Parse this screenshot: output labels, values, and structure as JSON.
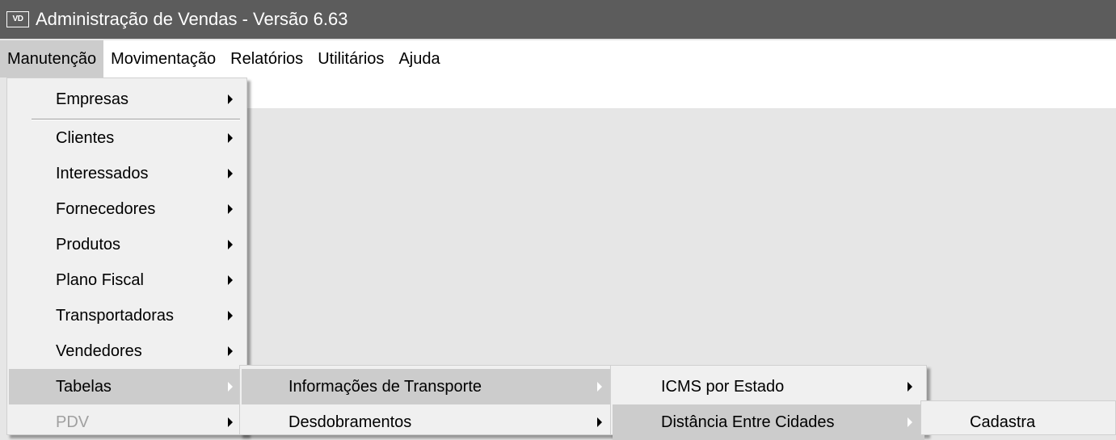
{
  "titlebar": {
    "icon_text": "VD",
    "title": "Administração de Vendas - Versão 6.63"
  },
  "menubar": {
    "items": [
      "Manutenção",
      "Movimentação",
      "Relatórios",
      "Utilitários",
      "Ajuda"
    ],
    "active_item": "Manutenção"
  },
  "menu_manutencao": {
    "items": [
      "Empresas",
      "Clientes",
      "Interessados",
      "Fornecedores",
      "Produtos",
      "Plano Fiscal",
      "Transportadoras",
      "Vendedores",
      "Tabelas",
      "PDV"
    ],
    "highlighted": "Tabelas",
    "disabled": [
      "PDV"
    ]
  },
  "menu_tabelas": {
    "items": [
      "Informações de Transporte",
      "Desdobramentos"
    ],
    "highlighted": "Informações de Transporte"
  },
  "menu_transporte": {
    "items": [
      "ICMS por Estado",
      "Distância Entre Cidades"
    ],
    "highlighted": "Distância Entre Cidades"
  },
  "menu_distancia": {
    "items": [
      "Cadastra"
    ]
  },
  "colors": {
    "titlebar_bg": "#5c5c5c",
    "menu_bg": "#f0f0f0",
    "highlight_bg": "#cccccc",
    "workspace_bg": "#e6e6e6",
    "disabled_text": "#a0a0a0"
  }
}
